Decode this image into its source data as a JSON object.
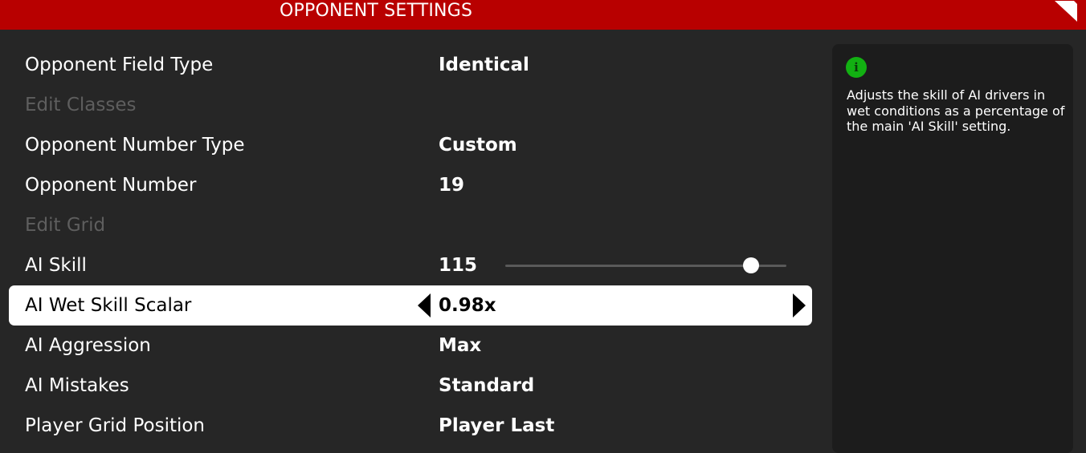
{
  "header": {
    "title": "OPPONENT SETTINGS",
    "corner_icon": "corner-fold-icon"
  },
  "settings": [
    {
      "label": "Opponent Field Type",
      "value": "Identical",
      "disabled": false
    },
    {
      "label": "Edit Classes",
      "value": "",
      "disabled": true
    },
    {
      "label": "Opponent Number Type",
      "value": "Custom",
      "disabled": false
    },
    {
      "label": "Opponent Number",
      "value": "19",
      "disabled": false
    },
    {
      "label": "Edit Grid",
      "value": "",
      "disabled": true
    },
    {
      "label": "AI Skill",
      "value": "115",
      "disabled": false,
      "slider_level": 0.875
    },
    {
      "label": "AI Wet Skill Scalar",
      "value": "0.98x",
      "disabled": false,
      "selected": true
    },
    {
      "label": "AI Aggression",
      "value": "Max",
      "disabled": false
    },
    {
      "label": "AI Mistakes",
      "value": "Standard",
      "disabled": false
    },
    {
      "label": "Player Grid Position",
      "value": "Player Last",
      "disabled": false
    }
  ],
  "info": {
    "icon": "info-icon",
    "icon_glyph": "i",
    "text": "Adjusts the skill of AI drivers in wet conditions as a percentage of the main 'AI Skill' setting."
  },
  "colors": {
    "header_bg": "#b80000",
    "background": "#262626",
    "panel_bg": "#1c1c1c",
    "info_icon": "#12b012",
    "selected_row_bg": "#ffffff",
    "disabled_text": "#5e5e5e"
  }
}
